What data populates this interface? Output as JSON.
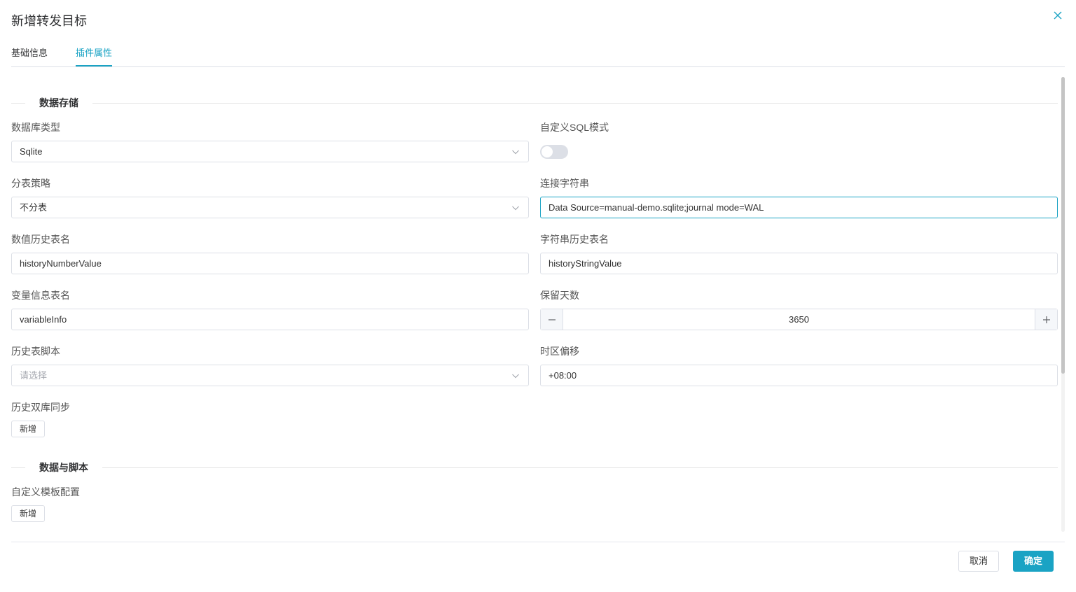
{
  "dialog": {
    "title": "新增转发目标",
    "close_icon": "close-icon"
  },
  "tabs": [
    {
      "label": "基础信息",
      "active": false
    },
    {
      "label": "插件属性",
      "active": true
    }
  ],
  "colors": {
    "accent": "#1aa3c4",
    "border": "#dcdfe6",
    "text": "#333333",
    "placeholder": "#a8abb2"
  },
  "sections": {
    "storage": {
      "title": "数据存储"
    },
    "script": {
      "title": "数据与脚本"
    }
  },
  "form": {
    "db_type": {
      "label": "数据库类型",
      "value": "Sqlite"
    },
    "custom_sql": {
      "label": "自定义SQL模式",
      "enabled": false
    },
    "split_strategy": {
      "label": "分表策略",
      "value": "不分表"
    },
    "conn_string": {
      "label": "连接字符串",
      "value": "Data Source=manual-demo.sqlite;journal mode=WAL"
    },
    "number_history_table": {
      "label": "数值历史表名",
      "value": "historyNumberValue"
    },
    "string_history_table": {
      "label": "字符串历史表名",
      "value": "historyStringValue"
    },
    "variable_info_table": {
      "label": "变量信息表名",
      "value": "variableInfo"
    },
    "retention_days": {
      "label": "保留天数",
      "value": "3650"
    },
    "history_script": {
      "label": "历史表脚本",
      "placeholder": "请选择"
    },
    "timezone_offset": {
      "label": "时区偏移",
      "value": "+08:00"
    },
    "dual_sync": {
      "label": "历史双库同步",
      "add_label": "新增"
    },
    "custom_template": {
      "label": "自定义模板配置",
      "add_label": "新增"
    }
  },
  "footer": {
    "cancel_label": "取消",
    "ok_label": "确定"
  }
}
